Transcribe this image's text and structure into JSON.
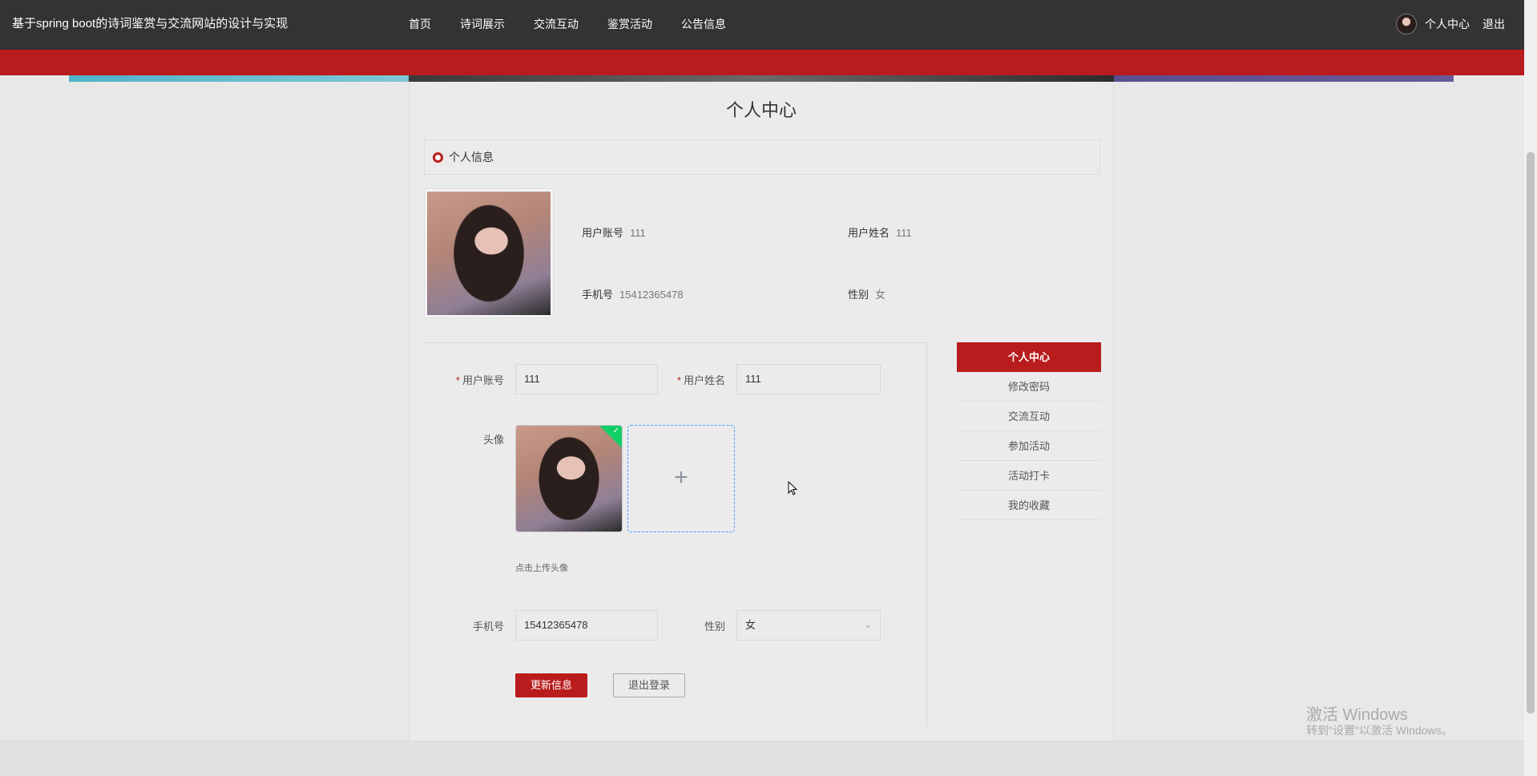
{
  "header": {
    "site_title": "基于spring boot的诗词鉴赏与交流网站的设计与实现",
    "nav": [
      "首页",
      "诗词展示",
      "交流互动",
      "鉴赏活动",
      "公告信息"
    ],
    "user_center": "个人中心",
    "logout": "退出"
  },
  "page": {
    "title": "个人中心",
    "section_title": "个人信息"
  },
  "info": {
    "account_label": "用户账号",
    "account_value": "111",
    "name_label": "用户姓名",
    "name_value": "111",
    "phone_label": "手机号",
    "phone_value": "15412365478",
    "gender_label": "性别",
    "gender_value": "女"
  },
  "form": {
    "account_label": "用户账号",
    "account_value": "111",
    "name_label": "用户姓名",
    "name_value": "111",
    "avatar_label": "头像",
    "upload_hint": "点击上传头像",
    "phone_label": "手机号",
    "phone_value": "15412365478",
    "gender_label": "性别",
    "gender_value": "女",
    "required_mark": "*",
    "plus": "+",
    "check": "✓",
    "update_button": "更新信息",
    "logout_button": "退出登录"
  },
  "side_menu": [
    "个人中心",
    "修改密码",
    "交流互动",
    "参加活动",
    "活动打卡",
    "我的收藏"
  ],
  "watermark": {
    "line1": "激活 Windows",
    "line2": "转到\"设置\"以激活 Windows。"
  },
  "colors": {
    "primary": "#b91c1c",
    "topbar": "#333333",
    "upload_border": "#409eff",
    "success": "#13ce66"
  }
}
